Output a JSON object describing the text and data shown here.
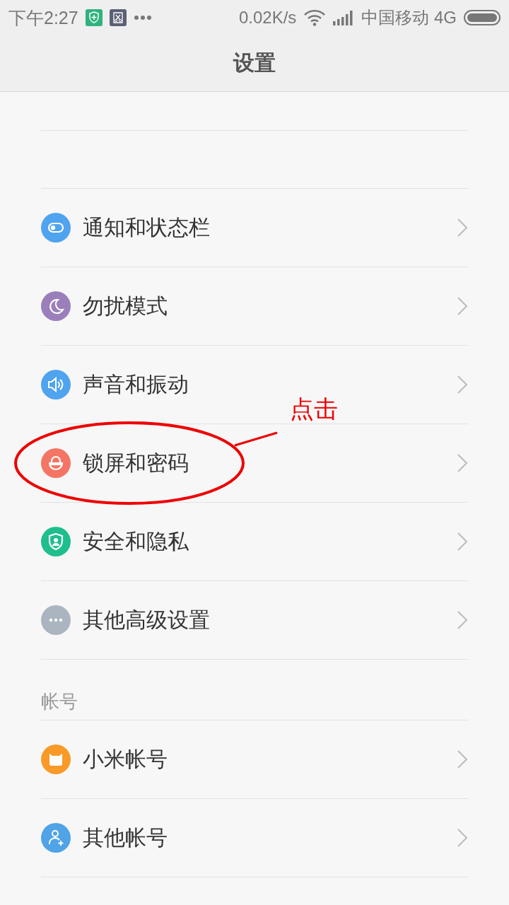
{
  "status_bar": {
    "time": "下午2:27",
    "speed": "0.02K/s",
    "carrier": "中国移动 4G"
  },
  "header": {
    "title": "设置"
  },
  "sections": [
    {
      "items": [
        {
          "label": "通知和状态栏",
          "kind": "toggle",
          "color": "#4fa3ef"
        },
        {
          "label": "勿扰模式",
          "kind": "moon",
          "color": "#9a7fbb"
        },
        {
          "label": "声音和振动",
          "kind": "speaker",
          "color": "#4fa3ef"
        },
        {
          "label": "锁屏和密码",
          "kind": "lock",
          "color": "#f47564",
          "callout": "点击"
        },
        {
          "label": "安全和隐私",
          "kind": "shield",
          "color": "#1ebe8d"
        },
        {
          "label": "其他高级设置",
          "kind": "dots",
          "color": "#aab5bf"
        }
      ]
    },
    {
      "title": "帐号",
      "items": [
        {
          "label": "小米帐号",
          "kind": "mi",
          "color": "#f99a28"
        },
        {
          "label": "其他帐号",
          "kind": "person",
          "color": "#4fa3e6"
        }
      ]
    }
  ]
}
